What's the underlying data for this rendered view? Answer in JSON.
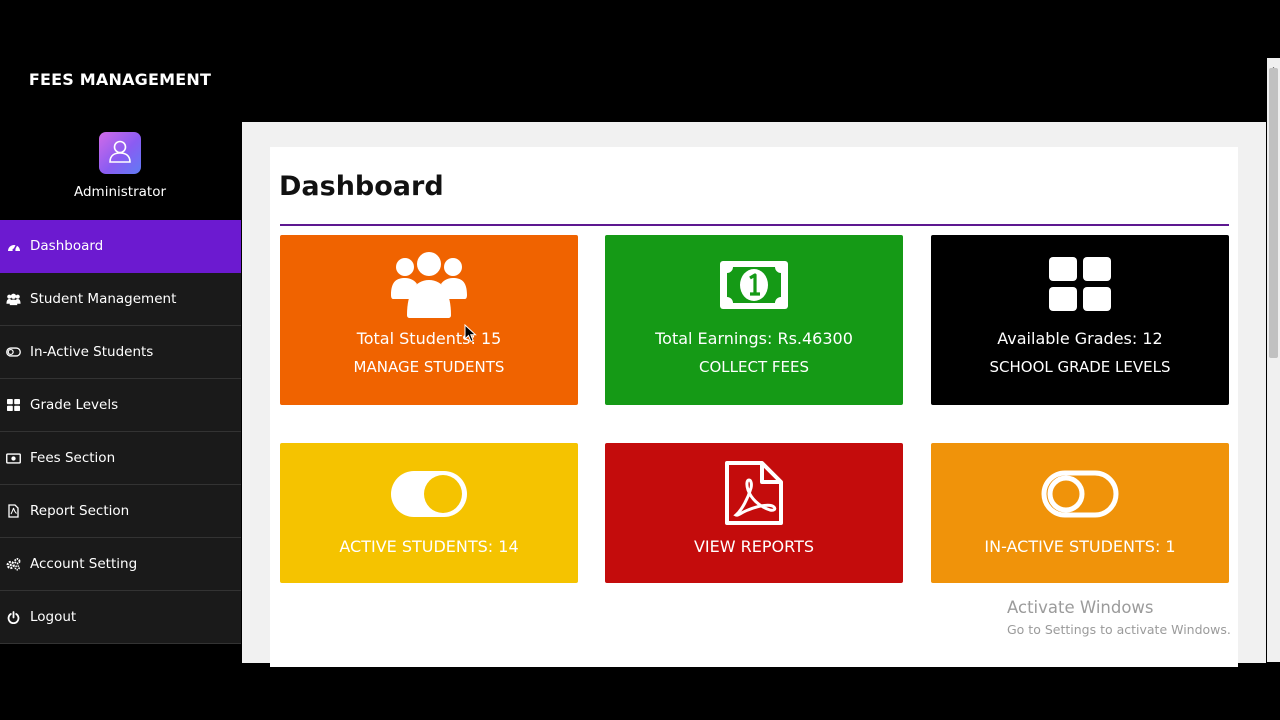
{
  "app": {
    "title": "FEES MANAGEMENT"
  },
  "user": {
    "role": "Administrator"
  },
  "sidebar": {
    "items": [
      {
        "label": "Dashboard",
        "icon": "dashboard-icon",
        "active": true
      },
      {
        "label": "Student Management",
        "icon": "users-icon"
      },
      {
        "label": "In-Active Students",
        "icon": "toggle-off-icon"
      },
      {
        "label": "Grade Levels",
        "icon": "grid-icon"
      },
      {
        "label": "Fees Section",
        "icon": "money-icon"
      },
      {
        "label": "Report Section",
        "icon": "pdf-file-icon"
      },
      {
        "label": "Account Setting",
        "icon": "cogs-icon"
      },
      {
        "label": "Logout",
        "icon": "power-icon"
      }
    ]
  },
  "main": {
    "title": "Dashboard",
    "tiles": [
      {
        "line1": "Total Students: 15",
        "line2": "MANAGE STUDENTS",
        "icon": "users-icon",
        "color": "#f06300"
      },
      {
        "line1": "Total Earnings: Rs.46300",
        "line2": "COLLECT FEES",
        "icon": "money-bill-icon",
        "color": "#159a16"
      },
      {
        "line1": "Available Grades: 12",
        "line2": "SCHOOL GRADE LEVELS",
        "icon": "grid-icon",
        "color": "#000000"
      },
      {
        "line1": "ACTIVE STUDENTS: 14",
        "icon": "toggle-on-icon",
        "color": "#f5c300"
      },
      {
        "line1": "VIEW REPORTS",
        "icon": "pdf-file-icon",
        "color": "#c40c0c"
      },
      {
        "line1": "IN-ACTIVE STUDENTS: 1",
        "icon": "toggle-off-icon",
        "color": "#f0930a"
      }
    ]
  },
  "watermark": {
    "line1": "Activate Windows",
    "line2": "Go to Settings to activate Windows."
  },
  "colors": {
    "sidebar_active": "#6c1ad0",
    "sidebar_bg": "#1a1a1a",
    "title_rule": "#5d1890"
  }
}
